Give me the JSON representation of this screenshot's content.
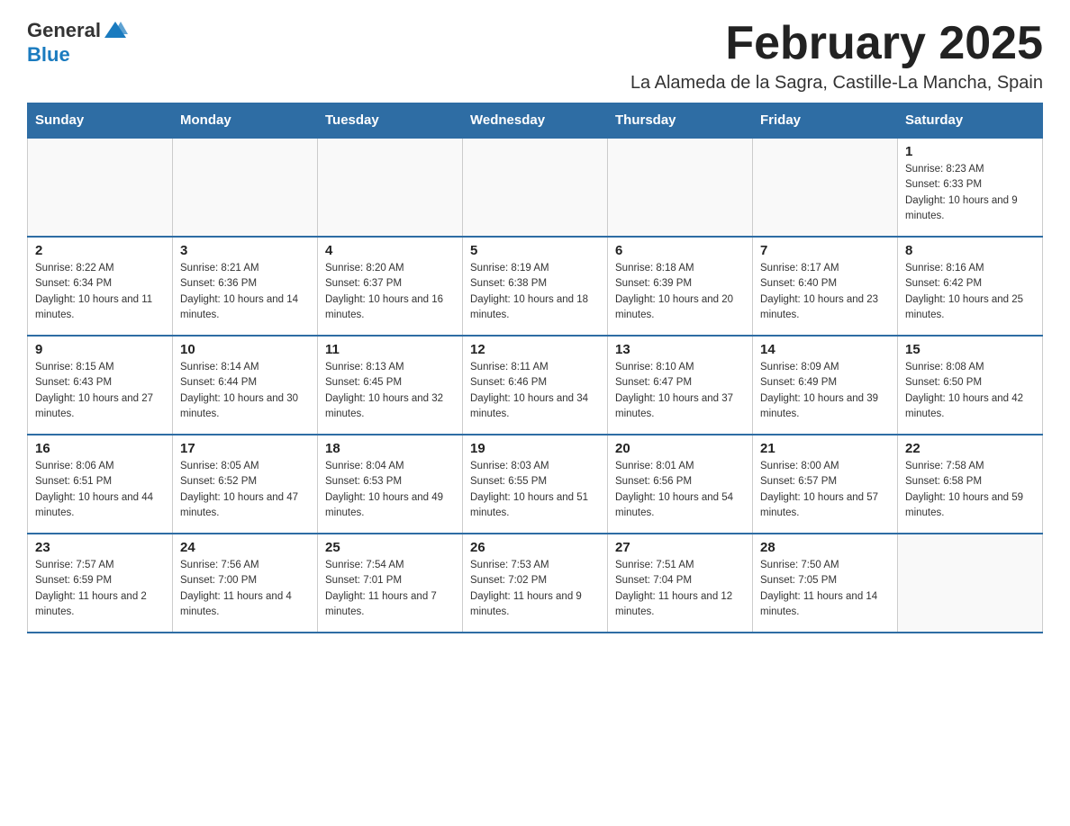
{
  "header": {
    "logo_text_general": "General",
    "logo_text_blue": "Blue",
    "month_year": "February 2025",
    "location": "La Alameda de la Sagra, Castille-La Mancha, Spain"
  },
  "weekdays": [
    "Sunday",
    "Monday",
    "Tuesday",
    "Wednesday",
    "Thursday",
    "Friday",
    "Saturday"
  ],
  "weeks": [
    [
      {
        "day": "",
        "info": ""
      },
      {
        "day": "",
        "info": ""
      },
      {
        "day": "",
        "info": ""
      },
      {
        "day": "",
        "info": ""
      },
      {
        "day": "",
        "info": ""
      },
      {
        "day": "",
        "info": ""
      },
      {
        "day": "1",
        "info": "Sunrise: 8:23 AM\nSunset: 6:33 PM\nDaylight: 10 hours and 9 minutes."
      }
    ],
    [
      {
        "day": "2",
        "info": "Sunrise: 8:22 AM\nSunset: 6:34 PM\nDaylight: 10 hours and 11 minutes."
      },
      {
        "day": "3",
        "info": "Sunrise: 8:21 AM\nSunset: 6:36 PM\nDaylight: 10 hours and 14 minutes."
      },
      {
        "day": "4",
        "info": "Sunrise: 8:20 AM\nSunset: 6:37 PM\nDaylight: 10 hours and 16 minutes."
      },
      {
        "day": "5",
        "info": "Sunrise: 8:19 AM\nSunset: 6:38 PM\nDaylight: 10 hours and 18 minutes."
      },
      {
        "day": "6",
        "info": "Sunrise: 8:18 AM\nSunset: 6:39 PM\nDaylight: 10 hours and 20 minutes."
      },
      {
        "day": "7",
        "info": "Sunrise: 8:17 AM\nSunset: 6:40 PM\nDaylight: 10 hours and 23 minutes."
      },
      {
        "day": "8",
        "info": "Sunrise: 8:16 AM\nSunset: 6:42 PM\nDaylight: 10 hours and 25 minutes."
      }
    ],
    [
      {
        "day": "9",
        "info": "Sunrise: 8:15 AM\nSunset: 6:43 PM\nDaylight: 10 hours and 27 minutes."
      },
      {
        "day": "10",
        "info": "Sunrise: 8:14 AM\nSunset: 6:44 PM\nDaylight: 10 hours and 30 minutes."
      },
      {
        "day": "11",
        "info": "Sunrise: 8:13 AM\nSunset: 6:45 PM\nDaylight: 10 hours and 32 minutes."
      },
      {
        "day": "12",
        "info": "Sunrise: 8:11 AM\nSunset: 6:46 PM\nDaylight: 10 hours and 34 minutes."
      },
      {
        "day": "13",
        "info": "Sunrise: 8:10 AM\nSunset: 6:47 PM\nDaylight: 10 hours and 37 minutes."
      },
      {
        "day": "14",
        "info": "Sunrise: 8:09 AM\nSunset: 6:49 PM\nDaylight: 10 hours and 39 minutes."
      },
      {
        "day": "15",
        "info": "Sunrise: 8:08 AM\nSunset: 6:50 PM\nDaylight: 10 hours and 42 minutes."
      }
    ],
    [
      {
        "day": "16",
        "info": "Sunrise: 8:06 AM\nSunset: 6:51 PM\nDaylight: 10 hours and 44 minutes."
      },
      {
        "day": "17",
        "info": "Sunrise: 8:05 AM\nSunset: 6:52 PM\nDaylight: 10 hours and 47 minutes."
      },
      {
        "day": "18",
        "info": "Sunrise: 8:04 AM\nSunset: 6:53 PM\nDaylight: 10 hours and 49 minutes."
      },
      {
        "day": "19",
        "info": "Sunrise: 8:03 AM\nSunset: 6:55 PM\nDaylight: 10 hours and 51 minutes."
      },
      {
        "day": "20",
        "info": "Sunrise: 8:01 AM\nSunset: 6:56 PM\nDaylight: 10 hours and 54 minutes."
      },
      {
        "day": "21",
        "info": "Sunrise: 8:00 AM\nSunset: 6:57 PM\nDaylight: 10 hours and 57 minutes."
      },
      {
        "day": "22",
        "info": "Sunrise: 7:58 AM\nSunset: 6:58 PM\nDaylight: 10 hours and 59 minutes."
      }
    ],
    [
      {
        "day": "23",
        "info": "Sunrise: 7:57 AM\nSunset: 6:59 PM\nDaylight: 11 hours and 2 minutes."
      },
      {
        "day": "24",
        "info": "Sunrise: 7:56 AM\nSunset: 7:00 PM\nDaylight: 11 hours and 4 minutes."
      },
      {
        "day": "25",
        "info": "Sunrise: 7:54 AM\nSunset: 7:01 PM\nDaylight: 11 hours and 7 minutes."
      },
      {
        "day": "26",
        "info": "Sunrise: 7:53 AM\nSunset: 7:02 PM\nDaylight: 11 hours and 9 minutes."
      },
      {
        "day": "27",
        "info": "Sunrise: 7:51 AM\nSunset: 7:04 PM\nDaylight: 11 hours and 12 minutes."
      },
      {
        "day": "28",
        "info": "Sunrise: 7:50 AM\nSunset: 7:05 PM\nDaylight: 11 hours and 14 minutes."
      },
      {
        "day": "",
        "info": ""
      }
    ]
  ]
}
